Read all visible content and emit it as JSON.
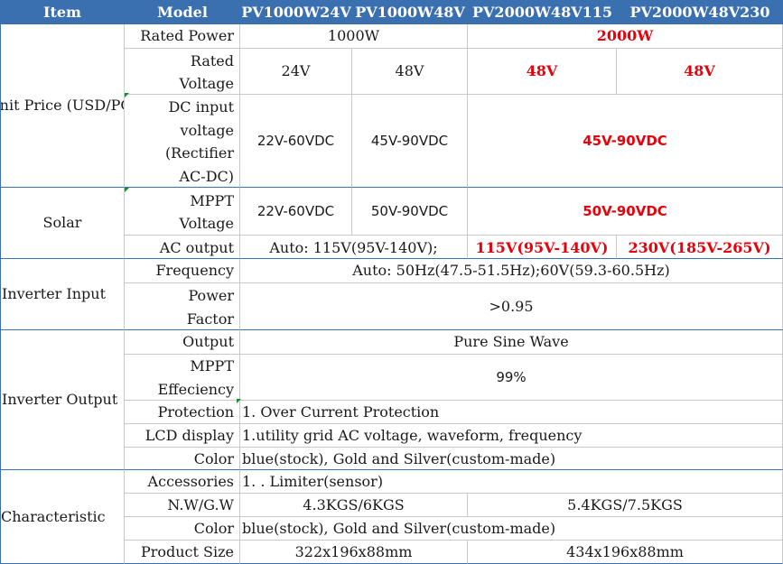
{
  "header": {
    "item": "Item",
    "model": "Model",
    "m1": "PV1000W24V",
    "m2": "PV1000W48V",
    "m3": "PV2000W48V115",
    "m4": "PV2000W48V230"
  },
  "unit_price": {
    "group": [
      "Unit Price",
      "(USD/PC)"
    ],
    "rated_power": {
      "label": "Rated Power",
      "v1000": "1000W",
      "v2000": "2000W"
    },
    "rated_voltage": {
      "label": [
        "Rated",
        "Voltage"
      ],
      "v1": "24V",
      "v2": "48V",
      "v3": "48V",
      "v4": "48V"
    },
    "dc_input": {
      "label": [
        "DC input",
        "voltage",
        "(Rectifier",
        "AC-DC)"
      ],
      "v1": "22V-60VDC",
      "v2": "45V-90VDC",
      "v34": "45V-90VDC"
    }
  },
  "solar": {
    "group": "Solar",
    "mppt": {
      "label": [
        "MPPT",
        "Voltage"
      ],
      "v1": "22V-60VDC",
      "v2": "50V-90VDC",
      "v34": "50V-90VDC"
    },
    "ac_output": {
      "label": "AC output",
      "v12": "Auto: 115V(95V-140V);",
      "v3": "115V(95V-140V)",
      "v4": "230V(185V-265V)"
    }
  },
  "inverter_input": {
    "group": "Inverter Input",
    "frequency": {
      "label": "Frequency",
      "value": "Auto: 50Hz(47.5-51.5Hz);60V(59.3-60.5Hz)"
    },
    "power_factor": {
      "label": [
        "Power",
        "Factor"
      ],
      "value": ">0.95"
    }
  },
  "inverter_output": {
    "group": "Inverter Output",
    "output": {
      "label": "Output",
      "value": "Pure Sine Wave"
    },
    "mppt_eff": {
      "label": [
        "MPPT",
        "Effeciency"
      ],
      "value": "99%"
    },
    "protection": {
      "label": "Protection",
      "value": "1. Over Current Protection"
    },
    "lcd": {
      "label": "LCD display",
      "value": "1.utility grid AC voltage, waveform, frequency"
    },
    "color": {
      "label": "Color",
      "value": "blue(stock), Gold and Silver(custom-made)"
    }
  },
  "characteristic": {
    "group": "Characteristic",
    "accessories": {
      "label": "Accessories",
      "value": "1. . Limiter(sensor)"
    },
    "nw": {
      "label": "N.W/G.W",
      "v1000": "4.3KGS/6KGS",
      "v2000": "5.4KGS/7.5KGS"
    },
    "color": {
      "label": "Color",
      "value": "blue(stock), Gold and Silver(custom-made)"
    },
    "size": {
      "label": "Product Size",
      "v1000": "322x196x88mm",
      "v2000": "434x196x88mm"
    }
  },
  "colors": {
    "header_bg": "#3a6fb0",
    "highlight": "#e8000b",
    "grid": "#c9c9c9"
  }
}
